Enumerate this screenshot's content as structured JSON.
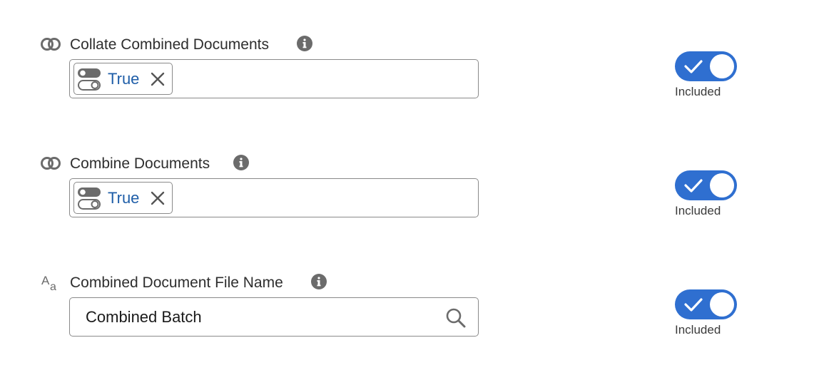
{
  "fields": [
    {
      "label": "Collate Combined Documents",
      "type_icon": "link-circles-icon",
      "value_type": "boolean-pill",
      "value": "True",
      "toggle_state": "on",
      "toggle_caption": "Included"
    },
    {
      "label": "Combine Documents",
      "type_icon": "link-circles-icon",
      "value_type": "boolean-pill",
      "value": "True",
      "toggle_state": "on",
      "toggle_caption": "Included"
    },
    {
      "label": "Combined Document File Name",
      "type_icon": "text-type-icon",
      "value_type": "text",
      "value": "Combined Batch",
      "toggle_state": "on",
      "toggle_caption": "Included"
    }
  ],
  "colors": {
    "toggle_on": "#2f6fd0",
    "pill_text": "#1f5ea8",
    "info_icon": "#6b6b6b",
    "border": "#8a8a8a"
  }
}
